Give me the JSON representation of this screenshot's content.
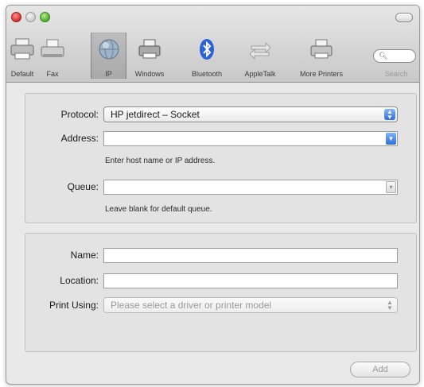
{
  "toolbar": {
    "items": [
      {
        "label": "Default",
        "icon": "default-printer-icon"
      },
      {
        "label": "Fax",
        "icon": "fax-icon"
      },
      {
        "label": "IP",
        "icon": "globe-icon"
      },
      {
        "label": "Windows",
        "icon": "windows-printer-icon"
      },
      {
        "label": "Bluetooth",
        "icon": "bluetooth-icon"
      },
      {
        "label": "AppleTalk",
        "icon": "appletalk-icon"
      },
      {
        "label": "More Printers",
        "icon": "more-printers-icon"
      }
    ],
    "selected": "IP",
    "search_label": "Search"
  },
  "connection": {
    "protocol_label": "Protocol:",
    "protocol_value": "HP jetdirect – Socket",
    "address_label": "Address:",
    "address_value": "",
    "address_hint": "Enter host name or IP address.",
    "queue_label": "Queue:",
    "queue_value": "",
    "queue_hint": "Leave blank for default queue."
  },
  "details": {
    "name_label": "Name:",
    "name_value": "",
    "location_label": "Location:",
    "location_value": "",
    "print_using_label": "Print Using:",
    "print_using_value": "Please select a driver or printer model"
  },
  "add_button_label": "Add",
  "colors": {
    "accent_blue": "#2e6fd8",
    "close_red": "#d0302f",
    "zoom_green": "#4ca82a"
  }
}
